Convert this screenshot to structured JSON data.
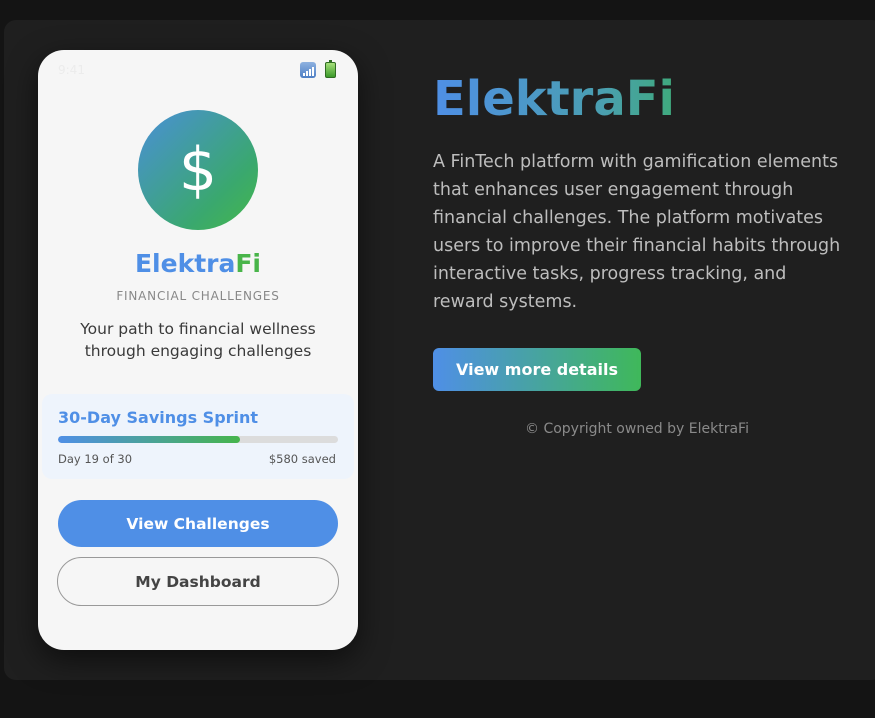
{
  "phone": {
    "status_time": "9:41",
    "status_icons": [
      "signal-icon",
      "battery-icon"
    ],
    "logo_symbol": "$",
    "brand_part1": "Elektra",
    "brand_part2": "Fi",
    "tagline": "FINANCIAL CHALLENGES",
    "description": "Your path to financial wellness through engaging challenges",
    "challenge": {
      "title": "30-Day Savings Sprint",
      "progress_fraction": 0.65,
      "day_text": "Day 19 of 30",
      "saved_text": "$580 saved"
    },
    "primary_button": "View Challenges",
    "secondary_button": "My Dashboard"
  },
  "hero": {
    "title": "ElektraFi",
    "description": "A FinTech platform with gamification elements that enhances user engagement through financial challenges. The platform motivates users to improve their financial habits through interactive tasks, progress tracking, and reward systems.",
    "details_button": "View more details",
    "copyright": "© Copyright owned by ElektraFi"
  },
  "colors": {
    "brand_blue": "#4f8fe6",
    "brand_green": "#49b54a",
    "background": "#141414",
    "card": "#1f1f1f"
  }
}
